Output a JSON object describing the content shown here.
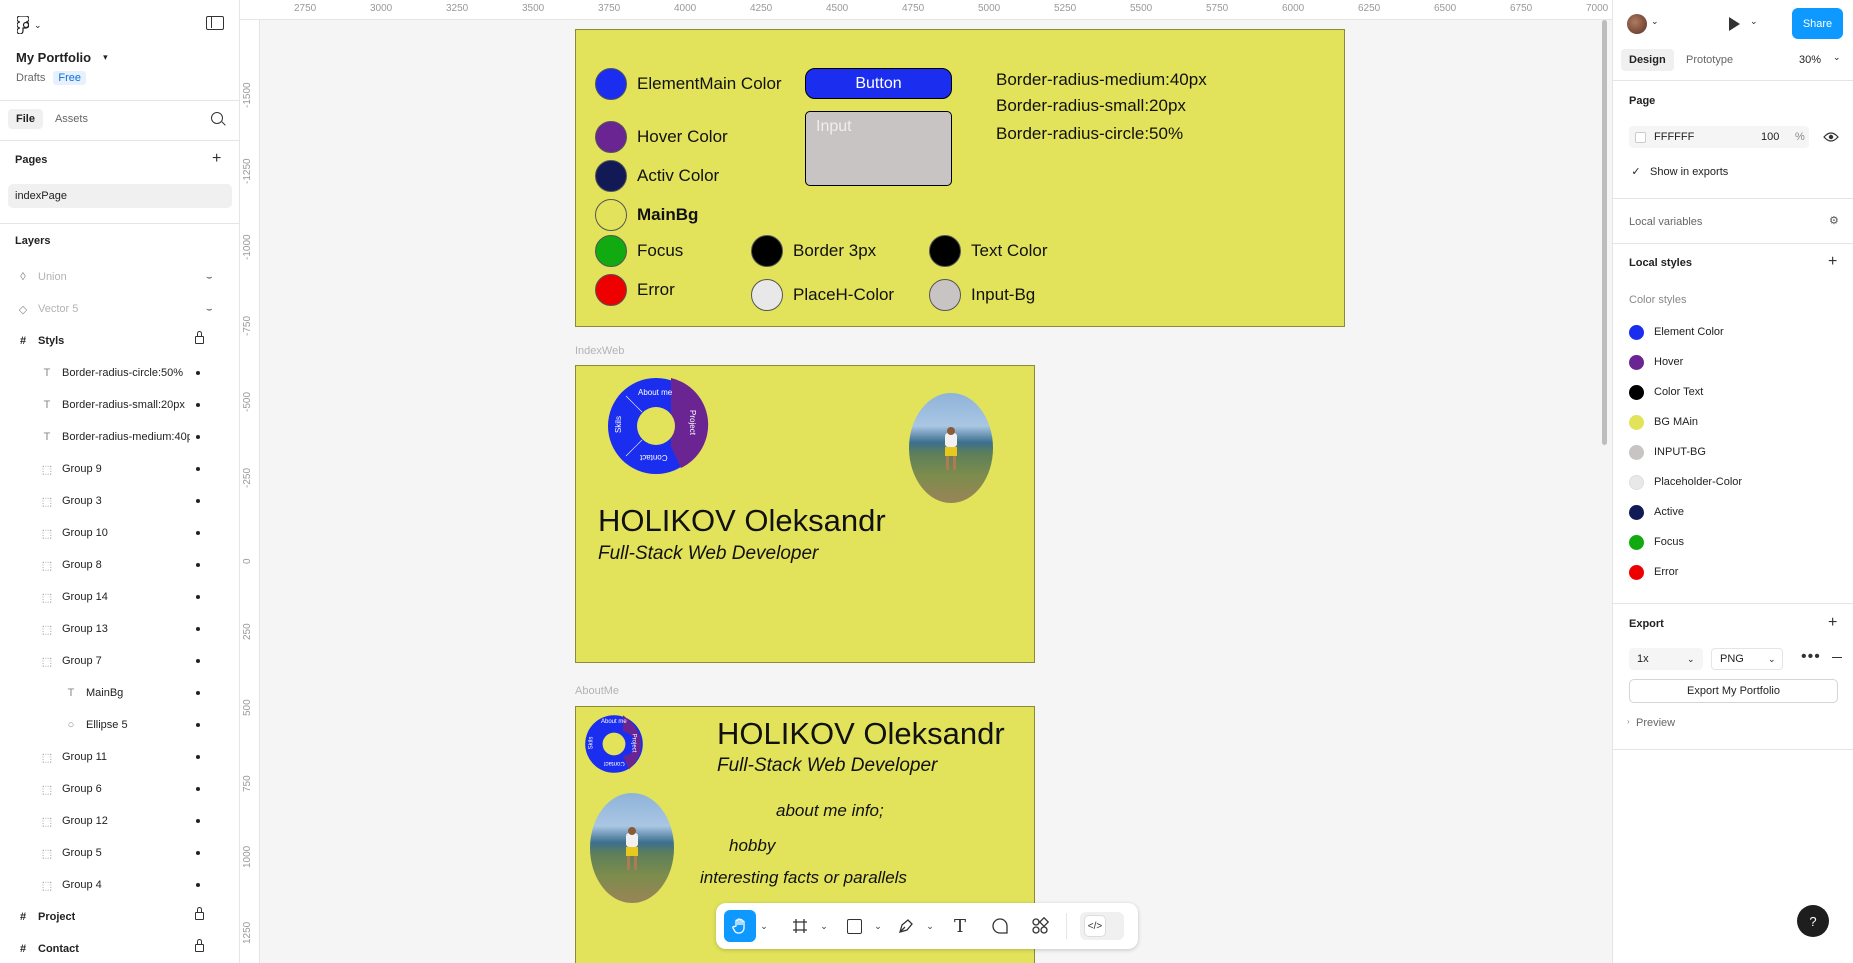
{
  "app": {
    "project_name": "My Portfolio",
    "location": "Drafts",
    "plan_badge": "Free"
  },
  "left_panel": {
    "tabs": [
      "File",
      "Assets"
    ],
    "pages_title": "Pages",
    "pages": [
      "indexPage"
    ],
    "layers_title": "Layers",
    "layers": [
      {
        "name": "Union",
        "icon": "union-icon",
        "hidden": true
      },
      {
        "name": "Vector 5",
        "icon": "vector-icon",
        "hidden": true
      },
      {
        "name": "Styls",
        "icon": "frame-icon",
        "locked": true
      },
      {
        "name": "Border-radius-circle:50%",
        "icon": "text-icon"
      },
      {
        "name": "Border-radius-small:20px",
        "icon": "text-icon"
      },
      {
        "name": "Border-radius-medium:40px",
        "icon": "text-icon"
      },
      {
        "name": "Group 9",
        "icon": "group-icon"
      },
      {
        "name": "Group 3",
        "icon": "group-icon"
      },
      {
        "name": "Group 10",
        "icon": "group-icon"
      },
      {
        "name": "Group 8",
        "icon": "group-icon"
      },
      {
        "name": "Group 14",
        "icon": "group-icon"
      },
      {
        "name": "Group 13",
        "icon": "group-icon"
      },
      {
        "name": "Group 7",
        "icon": "group-icon"
      },
      {
        "name": "MainBg",
        "icon": "text-icon"
      },
      {
        "name": "Ellipse 5",
        "icon": "ellipse-icon"
      },
      {
        "name": "Group 11",
        "icon": "group-icon"
      },
      {
        "name": "Group 6",
        "icon": "group-icon"
      },
      {
        "name": "Group 12",
        "icon": "group-icon"
      },
      {
        "name": "Group 5",
        "icon": "group-icon"
      },
      {
        "name": "Group 4",
        "icon": "group-icon"
      },
      {
        "name": "Project",
        "icon": "frame-icon",
        "locked": true
      },
      {
        "name": "Contact",
        "icon": "frame-icon",
        "locked": true
      }
    ]
  },
  "rulers": {
    "top": [
      "2750",
      "3000",
      "3250",
      "3500",
      "3750",
      "4000",
      "4250",
      "4500",
      "4750",
      "5000",
      "5250",
      "5500",
      "5750",
      "6000",
      "6250",
      "6500",
      "6750",
      "7000"
    ],
    "left": [
      "-1500",
      "-1250",
      "-1000",
      "-750",
      "-500",
      "-250",
      "0",
      "250",
      "500",
      "750",
      "1000",
      "1250"
    ]
  },
  "canvas": {
    "styls_frame": {
      "swatches": [
        {
          "label": "ElementMain Color",
          "color": "#1b2ef0"
        },
        {
          "label": "Hover Color",
          "color": "#6a2593"
        },
        {
          "label": "Activ Color",
          "color": "#121a55"
        },
        {
          "label": "MainBg",
          "color": "#e2e35b"
        },
        {
          "label": "Focus",
          "color": "#11aa11"
        },
        {
          "label": "Error",
          "color": "#ee0000"
        },
        {
          "label": "Border 3px",
          "color": "#000000"
        },
        {
          "label": "PlaceH-Color",
          "color": "#e8e8e8"
        },
        {
          "label": "Text Color",
          "color": "#000000"
        },
        {
          "label": "Input-Bg",
          "color": "#c9c4c4"
        }
      ],
      "button_label": "Button",
      "input_placeholder": "Input",
      "radius_notes": [
        "Border-radius-medium:40px",
        "Border-radius-small:20px",
        "Border-radius-circle:50%"
      ]
    },
    "index_frame": {
      "frame_label": "IndexWeb",
      "nav_items": [
        "About me",
        "Project",
        "Contact",
        "Skils"
      ],
      "name": "HOLIKOV Oleksandr",
      "role": "Full-Stack Web Developer"
    },
    "about_frame": {
      "frame_label": "AboutMe",
      "nav_items": [
        "About me",
        "Project",
        "Contact",
        "Skils"
      ],
      "name": "HOLIKOV Oleksandr",
      "role": "Full-Stack Web Developer",
      "lines": [
        "about me info;",
        "hobby",
        "interesting facts or parallels"
      ]
    }
  },
  "toolbar": {
    "tools": [
      "hand-tool",
      "frame-tool",
      "rectangle-tool",
      "pen-tool",
      "text-tool",
      "comment-tool",
      "resources-tool",
      "dev-mode-toggle"
    ]
  },
  "right_panel": {
    "share_label": "Share",
    "tabs": [
      "Design",
      "Prototype"
    ],
    "zoom": "30%",
    "page_title": "Page",
    "page_color": "FFFFFF",
    "page_opacity": "100",
    "percent": "%",
    "show_in_exports": "Show in exports",
    "local_variables": "Local variables",
    "local_styles": "Local styles",
    "color_styles_title": "Color styles",
    "color_styles": [
      {
        "name": "Element Color",
        "color": "#1b2ef0"
      },
      {
        "name": "Hover",
        "color": "#6a2593"
      },
      {
        "name": "Color Text",
        "color": "#000000"
      },
      {
        "name": "BG MAin",
        "color": "#e2e35b"
      },
      {
        "name": "INPUT-BG",
        "color": "#c9c4c4"
      },
      {
        "name": "Placeholder-Color",
        "color": "#e8e8e8"
      },
      {
        "name": "Active",
        "color": "#121a55"
      },
      {
        "name": "Focus",
        "color": "#11aa11"
      },
      {
        "name": "Error",
        "color": "#ee0000"
      }
    ],
    "export_title": "Export",
    "export_scale": "1x",
    "export_format": "PNG",
    "export_button": "Export My Portfolio",
    "preview_label": "Preview",
    "help_label": "?"
  }
}
